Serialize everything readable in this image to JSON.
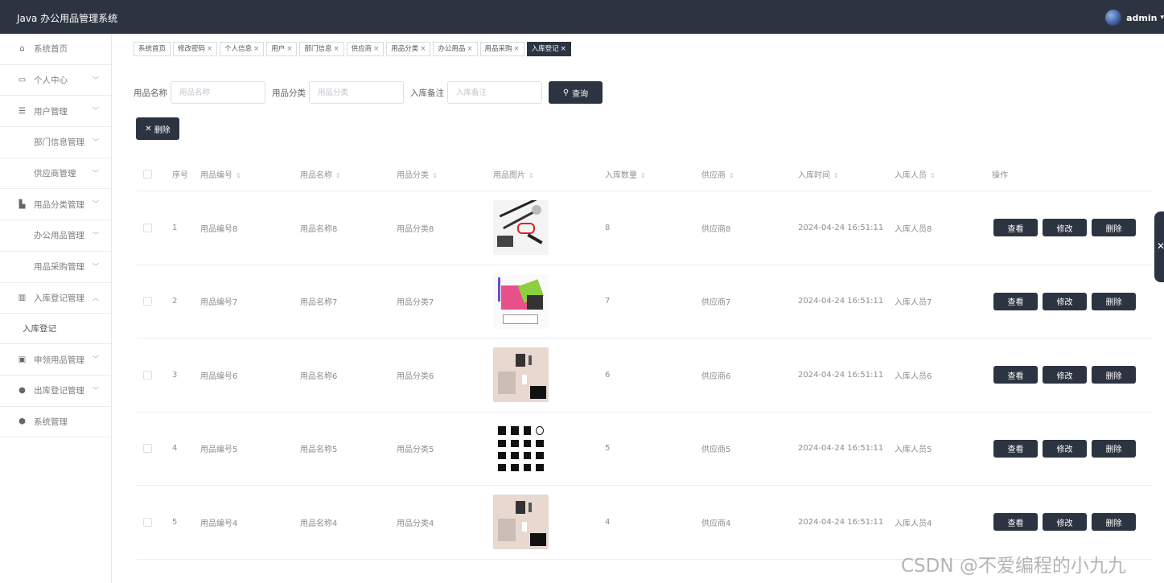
{
  "app": {
    "title": "Java 办公用品管理系统",
    "user": "admin"
  },
  "sidebar": {
    "items": [
      {
        "label": "系统首页",
        "icon": "home-icon",
        "has_children": false
      },
      {
        "label": "个人中心",
        "icon": "card-icon",
        "has_children": true
      },
      {
        "label": "用户管理",
        "icon": "sliders-icon",
        "has_children": true
      },
      {
        "label": "部门信息管理",
        "icon": "grid-icon",
        "has_children": true
      },
      {
        "label": "供应商管理",
        "icon": "grid-icon",
        "has_children": true
      },
      {
        "label": "用品分类管理",
        "icon": "building-icon",
        "has_children": true
      },
      {
        "label": "办公用品管理",
        "icon": "grid-icon",
        "has_children": true
      },
      {
        "label": "用品采购管理",
        "icon": "grid-icon",
        "has_children": true
      },
      {
        "label": "入库登记管理",
        "icon": "bars-icon",
        "has_children": true,
        "expanded": true
      }
    ],
    "sub_item": "入库登记",
    "items_after": [
      {
        "label": "申领用品管理",
        "icon": "clipboard-icon",
        "has_children": true
      },
      {
        "label": "出库登记管理",
        "icon": "user-icon",
        "has_children": true
      },
      {
        "label": "系统管理",
        "icon": "shield-icon",
        "has_children": false
      }
    ]
  },
  "tabs": [
    {
      "label": "系统首页",
      "closable": false
    },
    {
      "label": "修改密码",
      "closable": true
    },
    {
      "label": "个人信息",
      "closable": true
    },
    {
      "label": "用户",
      "closable": true
    },
    {
      "label": "部门信息",
      "closable": true
    },
    {
      "label": "供应商",
      "closable": true
    },
    {
      "label": "用品分类",
      "closable": true
    },
    {
      "label": "办公用品",
      "closable": true
    },
    {
      "label": "用品采购",
      "closable": true
    },
    {
      "label": "入库登记",
      "closable": true,
      "active": true
    }
  ],
  "search": {
    "name_label": "用品名称",
    "name_placeholder": "用品名称",
    "category_label": "用品分类",
    "category_placeholder": "用品分类",
    "remark_label": "入库备注",
    "remark_placeholder": "入库备注",
    "query_label": "查询",
    "delete_label": "删除"
  },
  "table": {
    "headers": [
      "序号",
      "用品编号",
      "用品名称",
      "用品分类",
      "用品图片",
      "入库数量",
      "供应商",
      "入库时间",
      "入库人员",
      "操作"
    ],
    "rows": [
      {
        "index": "1",
        "code": "用品编号8",
        "name": "用品名称8",
        "category": "用品分类8",
        "image": "stationery-flatlay",
        "qty": "8",
        "supplier": "供应商8",
        "time": "2024-04-24 16:51:11",
        "staff": "入库人员8"
      },
      {
        "index": "2",
        "code": "用品编号7",
        "name": "用品名称7",
        "category": "用品分类7",
        "image": "colorful-supplies",
        "qty": "7",
        "supplier": "供应商7",
        "time": "2024-04-24 16:51:11",
        "staff": "入库人员7"
      },
      {
        "index": "3",
        "code": "用品编号6",
        "name": "用品名称6",
        "category": "用品分类6",
        "image": "desk-items",
        "qty": "6",
        "supplier": "供应商6",
        "time": "2024-04-24 16:51:11",
        "staff": "入库人员6"
      },
      {
        "index": "4",
        "code": "用品编号5",
        "name": "用品名称5",
        "category": "用品分类5",
        "image": "icon-set",
        "qty": "5",
        "supplier": "供应商5",
        "time": "2024-04-24 16:51:11",
        "staff": "入库人员5"
      },
      {
        "index": "5",
        "code": "用品编号4",
        "name": "用品名称4",
        "category": "用品分类4",
        "image": "desk-items",
        "qty": "4",
        "supplier": "供应商4",
        "time": "2024-04-24 16:51:11",
        "staff": "入库人员4"
      }
    ],
    "actions": {
      "view": "查看",
      "edit": "修改",
      "delete": "删除"
    }
  },
  "watermark": "CSDN @不爱编程的小九九",
  "colors": {
    "topbar": "#2d3441",
    "button": "#2d3441",
    "border": "#ebeef5"
  }
}
